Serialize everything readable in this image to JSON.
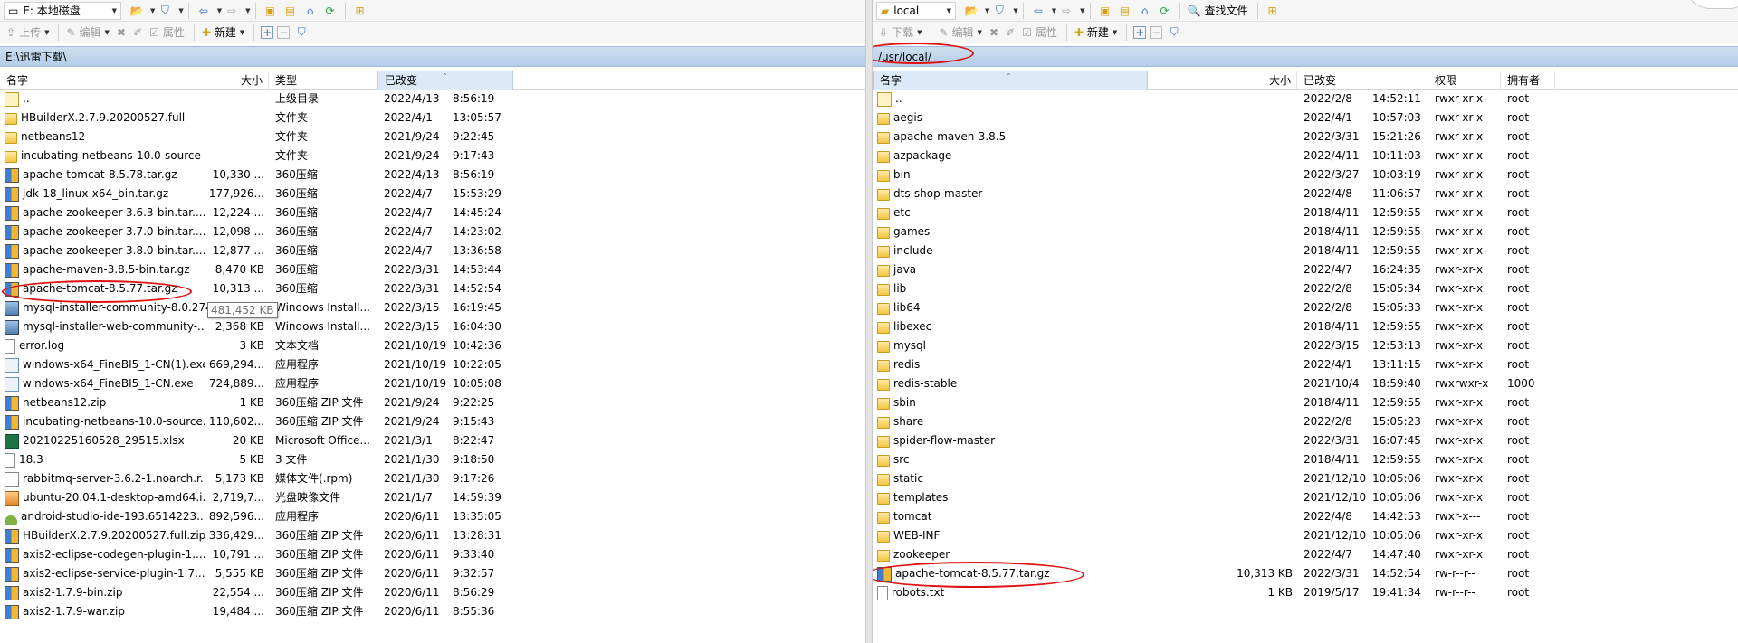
{
  "left": {
    "drive": "E: 本地磁盘",
    "toolbar2": {
      "upload": "上传",
      "edit": "编辑",
      "properties": "属性",
      "new": "新建"
    },
    "path": "E:\\迅雷下载\\",
    "columns": {
      "name": "名字",
      "size": "大小",
      "type": "类型",
      "modified": "已改变"
    },
    "files": [
      {
        "name": "..",
        "size": "",
        "type": "上级目录",
        "date": "2022/4/13",
        "time": "8:56:19",
        "icon": "up-folder"
      },
      {
        "name": "HBuilderX.2.7.9.20200527.full",
        "size": "",
        "type": "文件夹",
        "date": "2022/4/1",
        "time": "13:05:57",
        "icon": "folder"
      },
      {
        "name": "netbeans12",
        "size": "",
        "type": "文件夹",
        "date": "2021/9/24",
        "time": "9:22:45",
        "icon": "folder"
      },
      {
        "name": "incubating-netbeans-10.0-source",
        "size": "",
        "type": "文件夹",
        "date": "2021/9/24",
        "time": "9:17:43",
        "icon": "folder"
      },
      {
        "name": "apache-tomcat-8.5.78.tar.gz",
        "size": "10,330 ...",
        "type": "360压缩",
        "date": "2022/4/13",
        "time": "8:56:19",
        "icon": "archive"
      },
      {
        "name": "jdk-18_linux-x64_bin.tar.gz",
        "size": "177,926...",
        "type": "360压缩",
        "date": "2022/4/7",
        "time": "15:53:29",
        "icon": "archive"
      },
      {
        "name": "apache-zookeeper-3.6.3-bin.tar....",
        "size": "12,224 ...",
        "type": "360压缩",
        "date": "2022/4/7",
        "time": "14:45:24",
        "icon": "archive"
      },
      {
        "name": "apache-zookeeper-3.7.0-bin.tar....",
        "size": "12,098 ...",
        "type": "360压缩",
        "date": "2022/4/7",
        "time": "14:23:02",
        "icon": "archive"
      },
      {
        "name": "apache-zookeeper-3.8.0-bin.tar....",
        "size": "12,877 ...",
        "type": "360压缩",
        "date": "2022/4/7",
        "time": "13:36:58",
        "icon": "archive"
      },
      {
        "name": "apache-maven-3.8.5-bin.tar.gz",
        "size": "8,470 KB",
        "type": "360压缩",
        "date": "2022/3/31",
        "time": "14:53:44",
        "icon": "archive"
      },
      {
        "name": "apache-tomcat-8.5.77.tar.gz",
        "size": "10,313 ...",
        "type": "360压缩",
        "date": "2022/3/31",
        "time": "14:52:54",
        "icon": "archive"
      },
      {
        "name": "mysql-installer-community-8.0.27...",
        "size": "481,452 KB",
        "type": "Windows Install...",
        "date": "2022/3/15",
        "time": "16:19:45",
        "icon": "msi"
      },
      {
        "name": "mysql-installer-web-community-...",
        "size": "2,368 KB",
        "type": "Windows Install...",
        "date": "2022/3/15",
        "time": "16:04:30",
        "icon": "msi"
      },
      {
        "name": "error.log",
        "size": "3 KB",
        "type": "文本文档",
        "date": "2021/10/19",
        "time": "10:42:36",
        "icon": "doc"
      },
      {
        "name": "windows-x64_FineBI5_1-CN(1).exe",
        "size": "669,294...",
        "type": "应用程序",
        "date": "2021/10/19",
        "time": "10:22:05",
        "icon": "exe"
      },
      {
        "name": "windows-x64_FineBI5_1-CN.exe",
        "size": "724,889...",
        "type": "应用程序",
        "date": "2021/10/19",
        "time": "10:05:08",
        "icon": "exe"
      },
      {
        "name": "netbeans12.zip",
        "size": "1 KB",
        "type": "360压缩 ZIP 文件",
        "date": "2021/9/24",
        "time": "9:22:25",
        "icon": "archive"
      },
      {
        "name": "incubating-netbeans-10.0-source...",
        "size": "110,602...",
        "type": "360压缩 ZIP 文件",
        "date": "2021/9/24",
        "time": "9:15:43",
        "icon": "archive"
      },
      {
        "name": "20210225160528_29515.xlsx",
        "size": "20 KB",
        "type": "Microsoft Office...",
        "date": "2021/3/1",
        "time": "8:22:47",
        "icon": "xls"
      },
      {
        "name": "18.3",
        "size": "5 KB",
        "type": "3 文件",
        "date": "2021/1/30",
        "time": "9:18:50",
        "icon": "doc"
      },
      {
        "name": "rabbitmq-server-3.6.2-1.noarch.r...",
        "size": "5,173 KB",
        "type": "媒体文件(.rpm)",
        "date": "2021/1/30",
        "time": "9:17:26",
        "icon": "rpm"
      },
      {
        "name": "ubuntu-20.04.1-desktop-amd64.i...",
        "size": "2,719,7...",
        "type": "光盘映像文件",
        "date": "2021/1/7",
        "time": "14:59:39",
        "icon": "iso"
      },
      {
        "name": "android-studio-ide-193.6514223...",
        "size": "892,596...",
        "type": "应用程序",
        "date": "2020/6/11",
        "time": "13:35:05",
        "icon": "android"
      },
      {
        "name": "HBuilderX.2.7.9.20200527.full.zip",
        "size": "336,429...",
        "type": "360压缩 ZIP 文件",
        "date": "2020/6/11",
        "time": "13:28:31",
        "icon": "archive"
      },
      {
        "name": "axis2-eclipse-codegen-plugin-1....",
        "size": "10,791 ...",
        "type": "360压缩 ZIP 文件",
        "date": "2020/6/11",
        "time": "9:33:40",
        "icon": "archive"
      },
      {
        "name": "axis2-eclipse-service-plugin-1.7....",
        "size": "5,555 KB",
        "type": "360压缩 ZIP 文件",
        "date": "2020/6/11",
        "time": "9:32:57",
        "icon": "archive"
      },
      {
        "name": "axis2-1.7.9-bin.zip",
        "size": "22,554 ...",
        "type": "360压缩 ZIP 文件",
        "date": "2020/6/11",
        "time": "8:56:29",
        "icon": "archive"
      },
      {
        "name": "axis2-1.7.9-war.zip",
        "size": "19,484 ...",
        "type": "360压缩 ZIP 文件",
        "date": "2020/6/11",
        "time": "8:55:36",
        "icon": "archive"
      }
    ],
    "tooltip": "481,452 KB"
  },
  "right": {
    "drive": "local",
    "find_files": "查找文件",
    "toolbar2": {
      "download": "下载",
      "edit": "编辑",
      "properties": "属性",
      "new": "新建"
    },
    "path": "/usr/local/",
    "columns": {
      "name": "名字",
      "size": "大小",
      "modified": "已改变",
      "perms": "权限",
      "owner": "拥有者"
    },
    "files": [
      {
        "name": "..",
        "size": "",
        "date": "2022/2/8",
        "time": "14:52:11",
        "perms": "rwxr-xr-x",
        "owner": "root",
        "icon": "up-folder"
      },
      {
        "name": "aegis",
        "size": "",
        "date": "2022/4/1",
        "time": "10:57:03",
        "perms": "rwxr-xr-x",
        "owner": "root",
        "icon": "folder"
      },
      {
        "name": "apache-maven-3.8.5",
        "size": "",
        "date": "2022/3/31",
        "time": "15:21:26",
        "perms": "rwxr-xr-x",
        "owner": "root",
        "icon": "folder"
      },
      {
        "name": "azpackage",
        "size": "",
        "date": "2022/4/11",
        "time": "10:11:03",
        "perms": "rwxr-xr-x",
        "owner": "root",
        "icon": "folder"
      },
      {
        "name": "bin",
        "size": "",
        "date": "2022/3/27",
        "time": "10:03:19",
        "perms": "rwxr-xr-x",
        "owner": "root",
        "icon": "folder"
      },
      {
        "name": "dts-shop-master",
        "size": "",
        "date": "2022/4/8",
        "time": "11:06:57",
        "perms": "rwxr-xr-x",
        "owner": "root",
        "icon": "folder"
      },
      {
        "name": "etc",
        "size": "",
        "date": "2018/4/11",
        "time": "12:59:55",
        "perms": "rwxr-xr-x",
        "owner": "root",
        "icon": "folder"
      },
      {
        "name": "games",
        "size": "",
        "date": "2018/4/11",
        "time": "12:59:55",
        "perms": "rwxr-xr-x",
        "owner": "root",
        "icon": "folder"
      },
      {
        "name": "include",
        "size": "",
        "date": "2018/4/11",
        "time": "12:59:55",
        "perms": "rwxr-xr-x",
        "owner": "root",
        "icon": "folder"
      },
      {
        "name": "java",
        "size": "",
        "date": "2022/4/7",
        "time": "16:24:35",
        "perms": "rwxr-xr-x",
        "owner": "root",
        "icon": "folder"
      },
      {
        "name": "lib",
        "size": "",
        "date": "2022/2/8",
        "time": "15:05:34",
        "perms": "rwxr-xr-x",
        "owner": "root",
        "icon": "folder"
      },
      {
        "name": "lib64",
        "size": "",
        "date": "2022/2/8",
        "time": "15:05:33",
        "perms": "rwxr-xr-x",
        "owner": "root",
        "icon": "folder"
      },
      {
        "name": "libexec",
        "size": "",
        "date": "2018/4/11",
        "time": "12:59:55",
        "perms": "rwxr-xr-x",
        "owner": "root",
        "icon": "folder"
      },
      {
        "name": "mysql",
        "size": "",
        "date": "2022/3/15",
        "time": "12:53:13",
        "perms": "rwxr-xr-x",
        "owner": "root",
        "icon": "folder"
      },
      {
        "name": "redis",
        "size": "",
        "date": "2022/4/1",
        "time": "13:11:15",
        "perms": "rwxr-xr-x",
        "owner": "root",
        "icon": "folder"
      },
      {
        "name": "redis-stable",
        "size": "",
        "date": "2021/10/4",
        "time": "18:59:40",
        "perms": "rwxrwxr-x",
        "owner": "1000",
        "icon": "folder"
      },
      {
        "name": "sbin",
        "size": "",
        "date": "2018/4/11",
        "time": "12:59:55",
        "perms": "rwxr-xr-x",
        "owner": "root",
        "icon": "folder"
      },
      {
        "name": "share",
        "size": "",
        "date": "2022/2/8",
        "time": "15:05:23",
        "perms": "rwxr-xr-x",
        "owner": "root",
        "icon": "folder"
      },
      {
        "name": "spider-flow-master",
        "size": "",
        "date": "2022/3/31",
        "time": "16:07:45",
        "perms": "rwxr-xr-x",
        "owner": "root",
        "icon": "folder"
      },
      {
        "name": "src",
        "size": "",
        "date": "2018/4/11",
        "time": "12:59:55",
        "perms": "rwxr-xr-x",
        "owner": "root",
        "icon": "folder"
      },
      {
        "name": "static",
        "size": "",
        "date": "2021/12/10",
        "time": "10:05:06",
        "perms": "rwxr-xr-x",
        "owner": "root",
        "icon": "folder"
      },
      {
        "name": "templates",
        "size": "",
        "date": "2021/12/10",
        "time": "10:05:06",
        "perms": "rwxr-xr-x",
        "owner": "root",
        "icon": "folder"
      },
      {
        "name": "tomcat",
        "size": "",
        "date": "2022/4/8",
        "time": "14:42:53",
        "perms": "rwxr-x---",
        "owner": "root",
        "icon": "folder"
      },
      {
        "name": "WEB-INF",
        "size": "",
        "date": "2021/12/10",
        "time": "10:05:06",
        "perms": "rwxr-xr-x",
        "owner": "root",
        "icon": "folder"
      },
      {
        "name": "zookeeper",
        "size": "",
        "date": "2022/4/7",
        "time": "14:47:40",
        "perms": "rwxr-xr-x",
        "owner": "root",
        "icon": "folder"
      },
      {
        "name": "apache-tomcat-8.5.77.tar.gz",
        "size": "10,313 KB",
        "date": "2022/3/31",
        "time": "14:52:54",
        "perms": "rw-r--r--",
        "owner": "root",
        "icon": "archive"
      },
      {
        "name": "robots.txt",
        "size": "1 KB",
        "date": "2019/5/17",
        "time": "19:41:34",
        "perms": "rw-r--r--",
        "owner": "root",
        "icon": "doc"
      }
    ]
  }
}
